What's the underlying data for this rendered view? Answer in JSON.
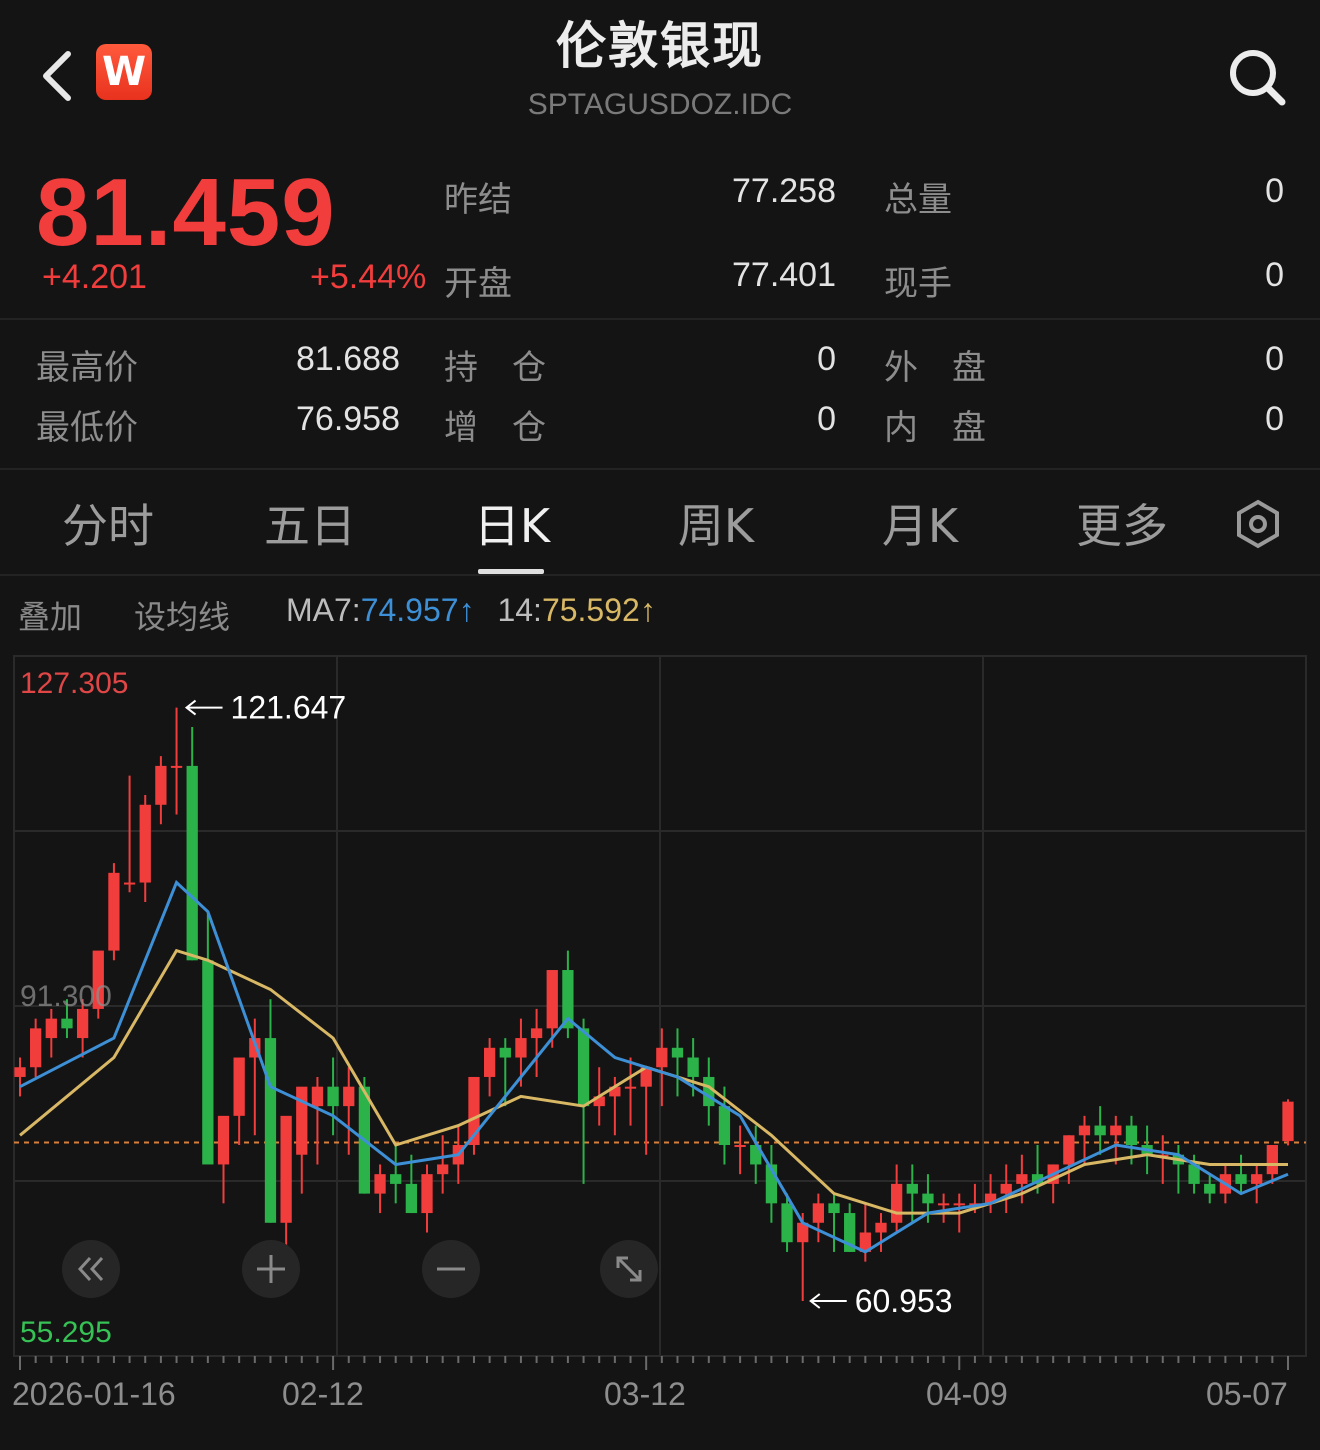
{
  "header": {
    "title": "伦敦银现",
    "subtitle": "SPTAGUSDOZ.IDC",
    "logo_text": "W",
    "icons": {
      "back": "back-chevron-icon",
      "search": "search-icon"
    }
  },
  "quote": {
    "last_price": "81.459",
    "change": "+4.201",
    "change_pct": "+5.44%",
    "stats": [
      {
        "label": "昨结",
        "value": "77.258"
      },
      {
        "label": "总量",
        "value": "0"
      },
      {
        "label": "开盘",
        "value": "77.401"
      },
      {
        "label": "现手",
        "value": "0"
      },
      {
        "label": "最高价",
        "value": "81.688"
      },
      {
        "label": "持　仓",
        "value": "0"
      },
      {
        "label": "外　盘",
        "value": "0"
      },
      {
        "label": "最低价",
        "value": "76.958"
      },
      {
        "label": "增　仓",
        "value": "0"
      },
      {
        "label": "内　盘",
        "value": "0"
      }
    ]
  },
  "tabs": [
    {
      "label": "分时"
    },
    {
      "label": "五日"
    },
    {
      "label": "日K",
      "active": true
    },
    {
      "label": "周K"
    },
    {
      "label": "月K"
    },
    {
      "label": "更多"
    }
  ],
  "indicators": {
    "overlay_label": "叠加",
    "set_ma_label": "设均线",
    "ma7_label": "MA7",
    "ma7_value": "74.957",
    "ma14_label": "14",
    "ma14_value": "75.592",
    "arrow": "↑",
    "ma7_color": "#3d8fd6",
    "ma14_color": "#d8b765"
  },
  "colors": {
    "up": "#f23d3d",
    "down": "#2bb34a",
    "background": "#141414"
  },
  "chart_data": {
    "type": "candlestick",
    "y_axis": {
      "max_label": "127.305",
      "mid_label": "91.300",
      "min_label": "55.295",
      "range": [
        55.295,
        127.305
      ]
    },
    "annotations": {
      "high": "121.647",
      "low": "60.953"
    },
    "x_tick_labels": [
      "2026-01-16",
      "02-12",
      "03-12",
      "04-09",
      "05-07"
    ],
    "reference_price": 77.258,
    "candles": [
      [
        84,
        86,
        82,
        85
      ],
      [
        85,
        90,
        84,
        89
      ],
      [
        88,
        91,
        86,
        90
      ],
      [
        90,
        92,
        88,
        89
      ],
      [
        88,
        92,
        86,
        91
      ],
      [
        91,
        96,
        90,
        97
      ],
      [
        97,
        106,
        96,
        105
      ],
      [
        104,
        115,
        103,
        104
      ],
      [
        104,
        113,
        102,
        112
      ],
      [
        112,
        117,
        110,
        116
      ],
      [
        116,
        122,
        111,
        116
      ],
      [
        116,
        120,
        96,
        96
      ],
      [
        96,
        101,
        76,
        75
      ],
      [
        75,
        77,
        71,
        80
      ],
      [
        80,
        84,
        77,
        86
      ],
      [
        86,
        90,
        78,
        88
      ],
      [
        88,
        92,
        69,
        69
      ],
      [
        69,
        71,
        63,
        80
      ],
      [
        76,
        80,
        72,
        83
      ],
      [
        81,
        84,
        75,
        83
      ],
      [
        83,
        86,
        78,
        81
      ],
      [
        81,
        85,
        76,
        83
      ],
      [
        83,
        84,
        72,
        72
      ],
      [
        72,
        75,
        70,
        74
      ],
      [
        74,
        77,
        71,
        73
      ],
      [
        73,
        76,
        70,
        70
      ],
      [
        70,
        75,
        68,
        74
      ],
      [
        74,
        78,
        72,
        75
      ],
      [
        75,
        79,
        73,
        77
      ],
      [
        77,
        84,
        76,
        84
      ],
      [
        84,
        88,
        82,
        87
      ],
      [
        87,
        88,
        81,
        86
      ],
      [
        86,
        90,
        83,
        88
      ],
      [
        88,
        91,
        84,
        89
      ],
      [
        89,
        95,
        87,
        95
      ],
      [
        95,
        97,
        88,
        89
      ],
      [
        89,
        90,
        73,
        81
      ],
      [
        81,
        85,
        79,
        82
      ],
      [
        82,
        84,
        78,
        83
      ],
      [
        83,
        86,
        79,
        83
      ],
      [
        83,
        85,
        76,
        85
      ],
      [
        85,
        89,
        81,
        87
      ],
      [
        87,
        89,
        82,
        86
      ],
      [
        86,
        88,
        82,
        84
      ],
      [
        84,
        86,
        79,
        81
      ],
      [
        81,
        83,
        75,
        77
      ],
      [
        77,
        79,
        74,
        77
      ],
      [
        77,
        79,
        73,
        75
      ],
      [
        75,
        77,
        69,
        71
      ],
      [
        71,
        72,
        66,
        67
      ],
      [
        67,
        70,
        60.953,
        69
      ],
      [
        69,
        72,
        67,
        71
      ],
      [
        71,
        72,
        66,
        70
      ],
      [
        70,
        71,
        66,
        66
      ],
      [
        66,
        71,
        65,
        68
      ],
      [
        68,
        70,
        66,
        69
      ],
      [
        69,
        75,
        68,
        73
      ],
      [
        73,
        75,
        69,
        72
      ],
      [
        72,
        74,
        69,
        71
      ],
      [
        71,
        72,
        69,
        71
      ],
      [
        71,
        72,
        68,
        71
      ],
      [
        71,
        73,
        70,
        71
      ],
      [
        71,
        74,
        70,
        72
      ],
      [
        72,
        75,
        70,
        73
      ],
      [
        73,
        76,
        71,
        74
      ],
      [
        74,
        77,
        72,
        73
      ],
      [
        73,
        75,
        71,
        75
      ],
      [
        75,
        78,
        73,
        78
      ],
      [
        78,
        80,
        75,
        79
      ],
      [
        79,
        81,
        76,
        78
      ],
      [
        78,
        80,
        75,
        79
      ],
      [
        79,
        80,
        75,
        77
      ],
      [
        77,
        79,
        74,
        76
      ],
      [
        76,
        78,
        73,
        76
      ],
      [
        76,
        77,
        72,
        75
      ],
      [
        75,
        76,
        72,
        73
      ],
      [
        73,
        74,
        71,
        72
      ],
      [
        72,
        75,
        71,
        74
      ],
      [
        74,
        76,
        72,
        73
      ],
      [
        73,
        75,
        71,
        74
      ],
      [
        74,
        77,
        73,
        77
      ],
      [
        77.4,
        81.7,
        76.96,
        81.46
      ]
    ],
    "ma7": [
      [
        0,
        83
      ],
      [
        6,
        88
      ],
      [
        10,
        104
      ],
      [
        12,
        101
      ],
      [
        16,
        83
      ],
      [
        20,
        80
      ],
      [
        24,
        75
      ],
      [
        28,
        76
      ],
      [
        32,
        84
      ],
      [
        35,
        90
      ],
      [
        38,
        86
      ],
      [
        42,
        84
      ],
      [
        46,
        80
      ],
      [
        50,
        69
      ],
      [
        54,
        66
      ],
      [
        58,
        70
      ],
      [
        62,
        71
      ],
      [
        66,
        74
      ],
      [
        70,
        77
      ],
      [
        74,
        76
      ],
      [
        78,
        72
      ],
      [
        81,
        74
      ]
    ],
    "ma14": [
      [
        0,
        78
      ],
      [
        6,
        86
      ],
      [
        10,
        97
      ],
      [
        12,
        96
      ],
      [
        16,
        93
      ],
      [
        20,
        88
      ],
      [
        24,
        77
      ],
      [
        28,
        79
      ],
      [
        32,
        82
      ],
      [
        36,
        81
      ],
      [
        40,
        85
      ],
      [
        44,
        83
      ],
      [
        48,
        78
      ],
      [
        52,
        72
      ],
      [
        56,
        70
      ],
      [
        60,
        70
      ],
      [
        64,
        72
      ],
      [
        68,
        75
      ],
      [
        72,
        76
      ],
      [
        76,
        75
      ],
      [
        81,
        75
      ]
    ]
  },
  "controls": {
    "icons": [
      "rewind-icon",
      "zoom-in-icon",
      "zoom-out-icon",
      "fullscreen-icon"
    ]
  }
}
